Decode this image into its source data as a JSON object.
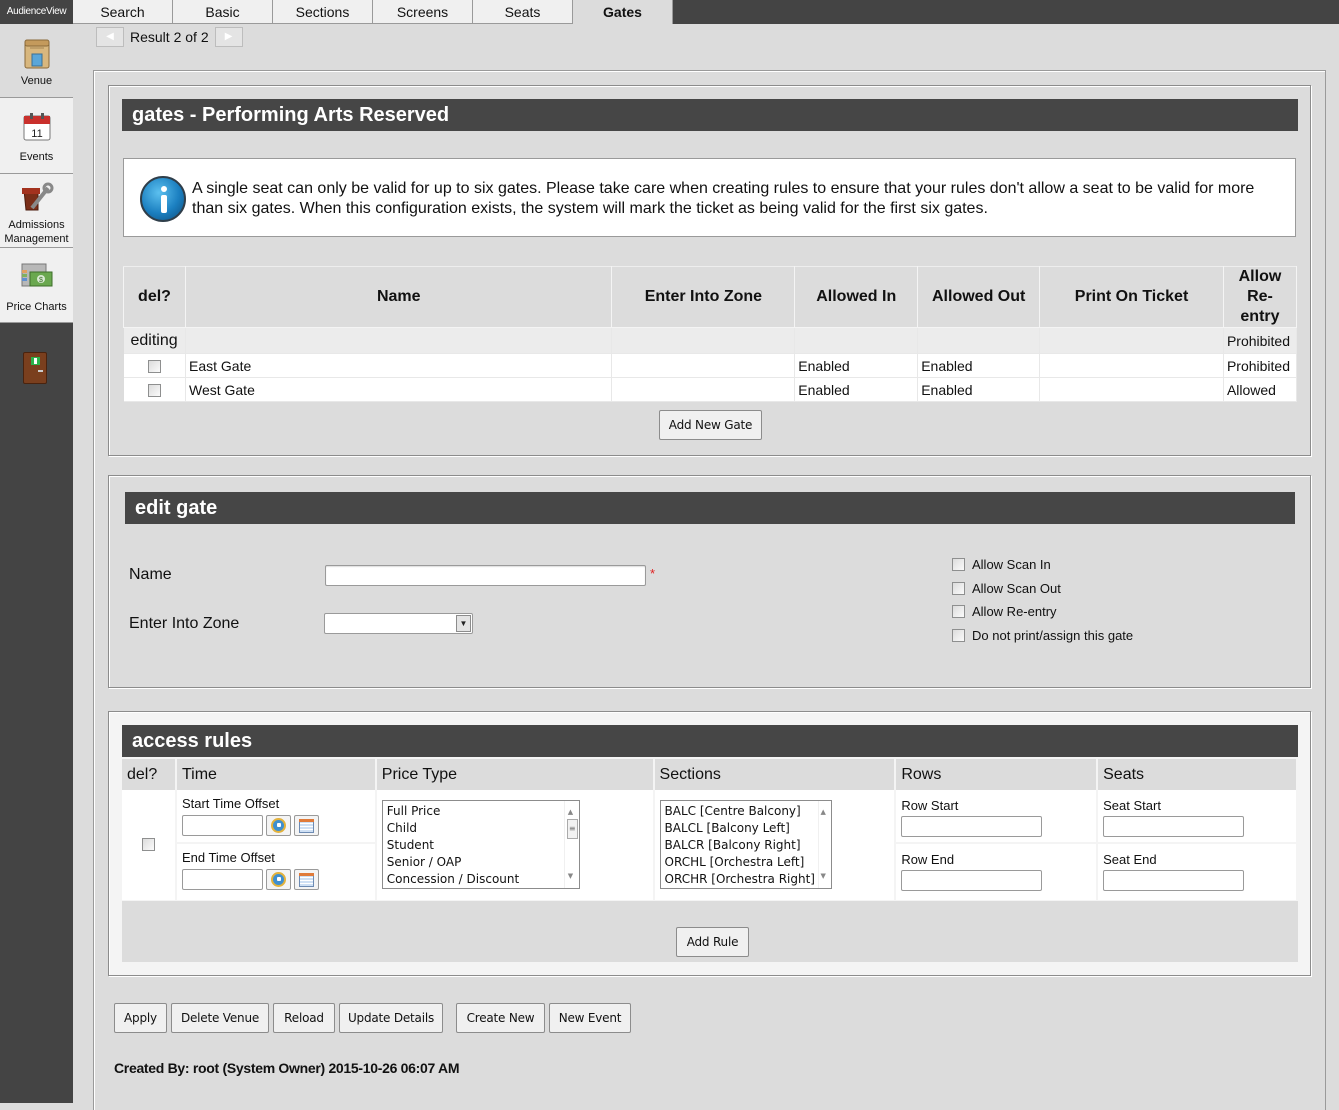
{
  "app": {
    "brand": "AudienceView"
  },
  "tabs": [
    {
      "label": "Search",
      "active": false
    },
    {
      "label": "Basic",
      "active": false
    },
    {
      "label": "Sections",
      "active": false
    },
    {
      "label": "Screens",
      "active": false
    },
    {
      "label": "Seats",
      "active": false
    },
    {
      "label": "Gates",
      "active": true
    }
  ],
  "sidebar": {
    "items": [
      {
        "label": "Venue",
        "icon": "building-icon",
        "active": true
      },
      {
        "label": "Events",
        "icon": "calendar-icon",
        "active": false
      },
      {
        "label": "Admissions Management",
        "label_line1": "Admissions",
        "label_line2": "Management",
        "icon": "chair-wrench-icon",
        "active": false
      },
      {
        "label": "Price Charts",
        "icon": "money-chart-icon",
        "active": false
      }
    ],
    "logout_icon": "exit-door-icon"
  },
  "pager": {
    "prev": "◀",
    "next": "▶",
    "text": "Result 2 of 2"
  },
  "gates_panel": {
    "title": "gates - Performing Arts Reserved",
    "info_text": "A single seat can only be valid for up to six gates. Please take care when creating rules to ensure that your rules don't allow a seat to be valid for more than six gates. When this configuration exists, the system will mark the ticket as being valid for the first six gates.",
    "columns": [
      "del?",
      "Name",
      "Enter Into Zone",
      "Allowed In",
      "Allowed Out",
      "Print On Ticket",
      "Allow Re-entry"
    ],
    "editing_row": {
      "label": "editing",
      "name": "",
      "zone": "",
      "allowed_in": "",
      "allowed_out": "",
      "print": "",
      "reentry": "Prohibited"
    },
    "rows": [
      {
        "name": "East Gate",
        "zone": "",
        "allowed_in": "Enabled",
        "allowed_out": "Enabled",
        "print": "",
        "reentry": "Prohibited",
        "del": false
      },
      {
        "name": "West Gate",
        "zone": "",
        "allowed_in": "Enabled",
        "allowed_out": "Enabled",
        "print": "",
        "reentry": "Allowed",
        "del": false
      }
    ],
    "add_button": "Add New Gate"
  },
  "edit_panel": {
    "title": "edit gate",
    "name_label": "Name",
    "name_value": "",
    "required_mark": "*",
    "zone_label": "Enter Into Zone",
    "zone_value": "",
    "checkboxes": [
      {
        "label": "Allow Scan In",
        "checked": false
      },
      {
        "label": "Allow Scan Out",
        "checked": false
      },
      {
        "label": "Allow Re-entry",
        "checked": false
      },
      {
        "label": "Do not print/assign this gate",
        "checked": false
      }
    ]
  },
  "rules_panel": {
    "title": "access rules",
    "columns": [
      "del?",
      "Time",
      "Price Type",
      "Sections",
      "Rows",
      "Seats"
    ],
    "start_time_label": "Start Time Offset",
    "end_time_label": "End Time Offset",
    "start_time_value": "",
    "end_time_value": "",
    "price_types": [
      "Full Price",
      "Child",
      "Student",
      "Senior / OAP",
      "Concession / Discount"
    ],
    "sections": [
      "BALC [Centre Balcony]",
      "BALCL [Balcony Left]",
      "BALCR [Balcony Right]",
      "ORCHL [Orchestra Left]",
      "ORCHR [Orchestra Right]"
    ],
    "row_start_label": "Row Start",
    "row_end_label": "Row End",
    "seat_start_label": "Seat Start",
    "seat_end_label": "Seat End",
    "row_start_value": "",
    "row_end_value": "",
    "seat_start_value": "",
    "seat_end_value": "",
    "add_button": "Add Rule"
  },
  "actions": [
    "Apply",
    "Delete Venue",
    "Reload",
    "Update Details",
    "Create New",
    "New Event"
  ],
  "footer": {
    "created_by": "Created By: root (System Owner) 2015-10-26 06:07 AM"
  },
  "colors": {
    "header_bg": "#464646",
    "page_bg": "#dcdcdc",
    "required": "#e02020"
  }
}
